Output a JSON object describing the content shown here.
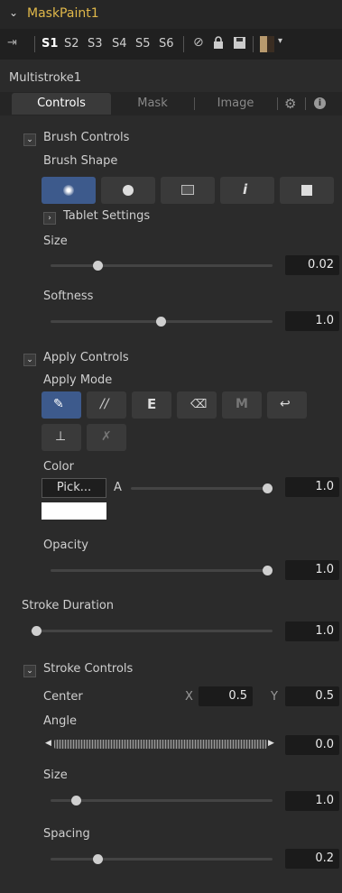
{
  "header": {
    "title": "MaskPaint1"
  },
  "toolbar": {
    "slots": [
      "S1",
      "S2",
      "S3",
      "S4",
      "S5",
      "S6"
    ]
  },
  "tool_name": "Multistroke1",
  "tabs": [
    "Controls",
    "Mask",
    "Image"
  ],
  "brush_controls": {
    "section": "Brush Controls",
    "shape_label": "Brush Shape",
    "tablet": "Tablet Settings",
    "size_label": "Size",
    "size_value": "0.02",
    "softness_label": "Softness",
    "softness_value": "1.0"
  },
  "apply_controls": {
    "section": "Apply Controls",
    "mode_label": "Apply Mode",
    "color_label": "Color",
    "pick_label": "Pick...",
    "alpha_label": "A",
    "alpha_value": "1.0",
    "opacity_label": "Opacity",
    "opacity_value": "1.0"
  },
  "stroke_duration": {
    "label": "Stroke Duration",
    "value": "1.0"
  },
  "stroke_controls": {
    "section": "Stroke Controls",
    "center_label": "Center",
    "x_label": "X",
    "x_value": "0.5",
    "y_label": "Y",
    "y_value": "0.5",
    "angle_label": "Angle",
    "angle_value": "0.0",
    "size_label": "Size",
    "size_value": "1.0",
    "spacing_label": "Spacing",
    "spacing_value": "0.2"
  },
  "colors": {
    "accent": "#3d5a8c",
    "header_text": "#e0b84a",
    "swatch": "#ffffff"
  }
}
